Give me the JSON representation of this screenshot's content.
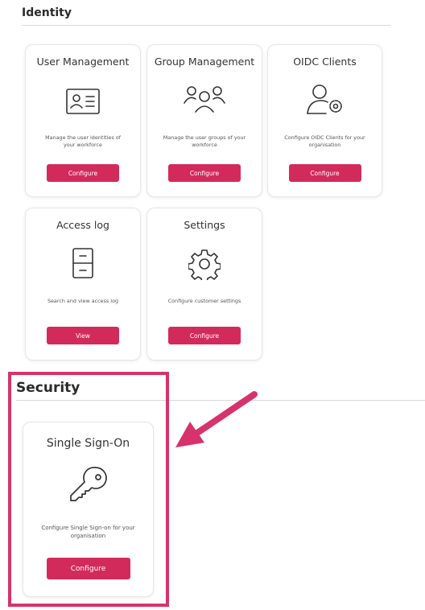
{
  "identity": {
    "title": "Identity",
    "cards": [
      {
        "title": "User Management",
        "icon": "id-card-icon",
        "description": "Manage the user identities of your workforce",
        "button": "Configure"
      },
      {
        "title": "Group Management",
        "icon": "user-group-icon",
        "description": "Manage the user groups of your workforce",
        "button": "Configure"
      },
      {
        "title": "OIDC Clients",
        "icon": "user-settings-icon",
        "description": "Configure OIDC Clients for your organisation",
        "button": "Configure"
      },
      {
        "title": "Access log",
        "icon": "file-cabinet-icon",
        "description": "Search and view access log",
        "button": "View"
      },
      {
        "title": "Settings",
        "icon": "gear-icon",
        "description": "Configure customer settings",
        "button": "Configure"
      }
    ]
  },
  "security": {
    "title": "Security",
    "cards": [
      {
        "title": "Single Sign-On",
        "icon": "key-icon",
        "description": "Configure Single Sign-on for your organisation",
        "button": "Configure"
      }
    ]
  },
  "colors": {
    "accent": "#d32a5c",
    "highlight": "#d6336c"
  }
}
